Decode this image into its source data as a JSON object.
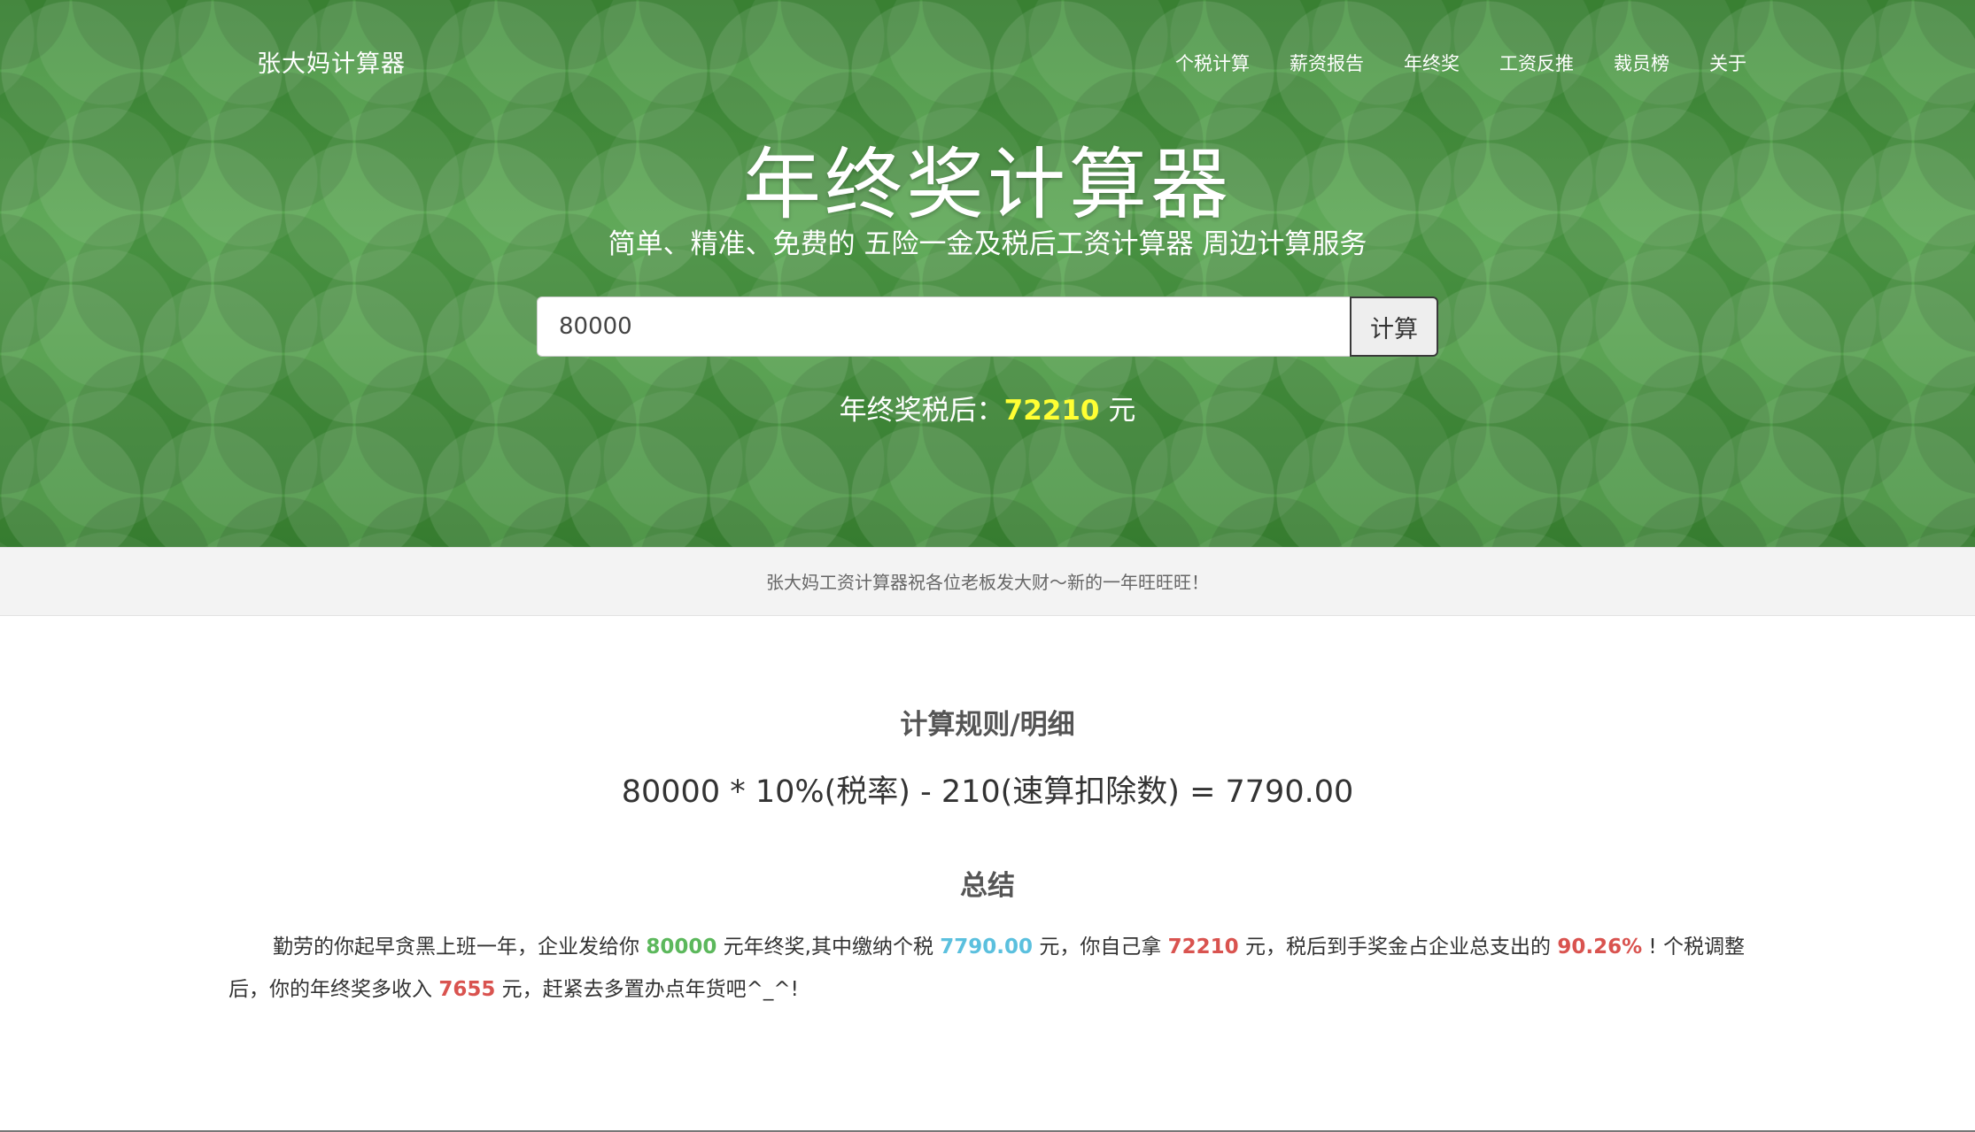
{
  "header": {
    "brand": "张大妈计算器",
    "nav": [
      "个税计算",
      "薪资报告",
      "年终奖",
      "工资反推",
      "裁员榜",
      "关于"
    ]
  },
  "hero": {
    "title": "年终奖计算器",
    "subtitle": "简单、精准、免费的 五险一金及税后工资计算器 周边计算服务",
    "input_value": "80000",
    "button_label": "计算",
    "result_prefix": "年终奖税后：",
    "result_amount": "72210",
    "result_unit": " 元"
  },
  "notice": "张大妈工资计算器祝各位老板发大财～新的一年旺旺旺！",
  "details": {
    "rules_title": "计算规则/明细",
    "formula": "80000 * 10%(税率) - 210(速算扣除数) = 7790.00",
    "summary_title": "总结",
    "summary": {
      "p1": "勤劳的你起早贪黑上班一年，企业发给你 ",
      "bonus": "80000",
      "p2": " 元年终奖,其中缴纳个税 ",
      "tax": "7790.00",
      "p3": " 元，你自己拿 ",
      "net": "72210",
      "p4": " 元，税后到手奖金占企业总支出的 ",
      "ratio": "90.26%",
      "p5": " ! 个税调整后，你的年终奖多收入 ",
      "extra": "7655",
      "p6": " 元，赶紧去多置办点年货吧^_^!"
    }
  },
  "colors": {
    "hero_green": "#4a9a42",
    "result_highlight": "#ffff33",
    "green": "#5cb85c",
    "cyan": "#5bc0de",
    "red": "#d9534f"
  }
}
